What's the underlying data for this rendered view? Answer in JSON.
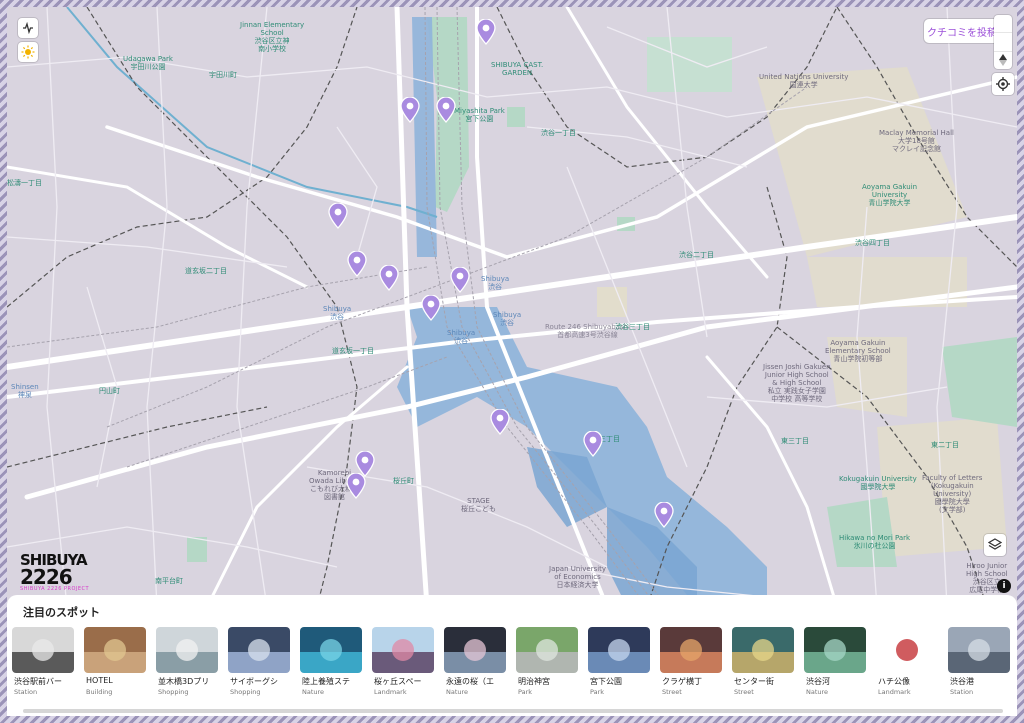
{
  "app": {
    "logo_line1": "SHIBUYA",
    "logo_line2": "2226",
    "logo_tagline": "SHIBUYA 2226 PROJECT"
  },
  "controls": {
    "post_review_label": "クチコミを投稿",
    "activity_icon": "activity-icon",
    "light_mode_icon": "sun-icon",
    "compass_icon": "compass-icon",
    "locate_icon": "locate-icon",
    "layers_icon": "layers-icon",
    "info_icon": "info-icon"
  },
  "colors": {
    "pin": "#a98be0",
    "accent": "#9b4fd8",
    "water": "#8fb4da",
    "park": "#b5d8c6",
    "land": "#d9d4df",
    "road_major": "#ffffff"
  },
  "map_labels": [
    {
      "id": "jinnan-school",
      "text": "Jinnan Elementary\nSchool\n渋谷区立神\n南小学校",
      "tone": "teal"
    },
    {
      "id": "udagawa-park",
      "text": "Udagawa Park\n宇田川公園",
      "tone": "teal"
    },
    {
      "id": "udagawacho",
      "text": "宇田川町",
      "tone": "teal"
    },
    {
      "id": "shibuya-cast",
      "text": "SHIBUYA CAST.\nGARDEN",
      "tone": "teal"
    },
    {
      "id": "miyashita-park",
      "text": "Miyashita Park\n宮下公園",
      "tone": "teal"
    },
    {
      "id": "shibuya-1",
      "text": "渋谷一丁目",
      "tone": "teal"
    },
    {
      "id": "unu",
      "text": "United Nations University\n国連大学",
      "tone": "dark"
    },
    {
      "id": "mcl",
      "text": "Maclay Memorial Hall\n大学18号館\nマクレイ記念館",
      "tone": "dark"
    },
    {
      "id": "aoyama-univ",
      "text": "Aoyama Gakuin\nUniversity\n青山学院大学",
      "tone": "teal"
    },
    {
      "id": "shibuya-4",
      "text": "渋谷四丁目",
      "tone": "teal"
    },
    {
      "id": "shibuya-2",
      "text": "渋谷二丁目",
      "tone": "teal"
    },
    {
      "id": "shoto-1",
      "text": "松濤一丁目",
      "tone": "teal"
    },
    {
      "id": "dogenzaka-2",
      "text": "道玄坂二丁目",
      "tone": "teal"
    },
    {
      "id": "dogenzaka-1",
      "text": "道玄坂一丁目",
      "tone": "teal"
    },
    {
      "id": "shibuya-station",
      "text": "Shibuya\n渋谷",
      "tone": "blue"
    },
    {
      "id": "shibuya-station-2",
      "text": "Shibuya\n渋谷",
      "tone": "blue"
    },
    {
      "id": "shibuya-station-3",
      "text": "Shibuya\n渋谷",
      "tone": "blue"
    },
    {
      "id": "shibuya-hikarie",
      "text": "Shibuya\n渋谷",
      "tone": "blue"
    },
    {
      "id": "shinsen",
      "text": "Shinsen\n神泉",
      "tone": "blue"
    },
    {
      "id": "maruyamacho",
      "text": "円山町",
      "tone": "teal"
    },
    {
      "id": "route246",
      "text": "Route 246 Shibuyabashi\n首都高速3号渋谷線",
      "tone": "gray"
    },
    {
      "id": "shibuya-3",
      "text": "渋谷三丁目",
      "tone": "teal"
    },
    {
      "id": "aoyama-elem",
      "text": "Aoyama Gakuin\nElementary School\n青山学院初等部",
      "tone": "dark"
    },
    {
      "id": "jissen",
      "text": "Jissen Joshi Gakuen\nJunior High School\n& High School\n私立 実践女子学園\n中学校 高等学校",
      "tone": "dark"
    },
    {
      "id": "higashi-3",
      "text": "東三丁目",
      "tone": "teal"
    },
    {
      "id": "higashi-2",
      "text": "東二丁目",
      "tone": "teal"
    },
    {
      "id": "kokugakuin",
      "text": "Kokugakuin University\n國學院大學",
      "tone": "teal"
    },
    {
      "id": "faculty-letters",
      "text": "Faculty of Letters\n(Kokugakuin\nUniversity)\n國學院大學\n(文学部)",
      "tone": "dark"
    },
    {
      "id": "hikawa-park",
      "text": "Hikawa no Mori Park\n氷川の杜公園",
      "tone": "teal"
    },
    {
      "id": "hiroo-school",
      "text": "Hiroo Junior\nHigh School\n渋谷区立\n広尾中学校",
      "tone": "dark"
    },
    {
      "id": "kamori",
      "text": "Kamorebi\nOwada Library\nこもれび大和田\n図書館",
      "tone": "dark"
    },
    {
      "id": "sakuragaoka",
      "text": "桜丘町",
      "tone": "teal"
    },
    {
      "id": "stage",
      "text": "STAGE\n桜丘こども",
      "tone": "dark"
    },
    {
      "id": "jue",
      "text": "Japan University\nof Economics\n日本経済大学",
      "tone": "dark"
    },
    {
      "id": "nanpeidai",
      "text": "南平台町",
      "tone": "teal"
    },
    {
      "id": "shibuya-3b",
      "text": "三丁目",
      "tone": "teal"
    }
  ],
  "spots_panel": {
    "title": "注目のスポット",
    "spots": [
      {
        "name": "渋谷駅前バー",
        "category": "Station",
        "c1": "#d8d8d8",
        "c2": "#5a5a5a",
        "c3": "#e9e9e9"
      },
      {
        "name": "HOTEL",
        "category": "Building",
        "c1": "#9a6d4a",
        "c2": "#c9a27a",
        "c3": "#e0c690"
      },
      {
        "name": "並木橋3Dプリ",
        "category": "Shopping",
        "c1": "#cfd6da",
        "c2": "#8a9ea6",
        "c3": "#f1f1f1"
      },
      {
        "name": "サイボーグシ",
        "category": "Shopping",
        "c1": "#3a4a66",
        "c2": "#8fa3c6",
        "c3": "#d8e1ee"
      },
      {
        "name": "陸上養殖ステ",
        "category": "Nature",
        "c1": "#1f5a7a",
        "c2": "#3aa6c6",
        "c3": "#78d3e6"
      },
      {
        "name": "桜ヶ丘スペー",
        "category": "Landmark",
        "c1": "#b8d4ea",
        "c2": "#6a5a7a",
        "c3": "#e08aa6"
      },
      {
        "name": "永遠の桜（エ",
        "category": "Nature",
        "c1": "#2a2e3a",
        "c2": "#7a8ea6",
        "c3": "#e6c6d6"
      },
      {
        "name": "明治神宮",
        "category": "Park",
        "c1": "#7aa66a",
        "c2": "#b0b6b0",
        "c3": "#dfe6df"
      },
      {
        "name": "宮下公園",
        "category": "Park",
        "c1": "#2e3a5a",
        "c2": "#6a8ab6",
        "c3": "#c6d6ee"
      },
      {
        "name": "クラゲ横丁",
        "category": "Street",
        "c1": "#5a3a3a",
        "c2": "#c67a5a",
        "c3": "#e6a66a"
      },
      {
        "name": "センター街",
        "category": "Street",
        "c1": "#3a6a6a",
        "c2": "#b6a66a",
        "c3": "#e6d68a"
      },
      {
        "name": "渋谷河",
        "category": "Nature",
        "c1": "#2a4a3a",
        "c2": "#6aa68a",
        "c3": "#a6d6c6"
      },
      {
        "name": "ハチ公像",
        "category": "Landmark",
        "c1": "#ffffff",
        "c2": "#ffffff",
        "c3": "#c0262a"
      },
      {
        "name": "渋谷港",
        "category": "Station",
        "c1": "#9aa6b6",
        "c2": "#5a6676",
        "c3": "#d6dee6"
      }
    ]
  }
}
